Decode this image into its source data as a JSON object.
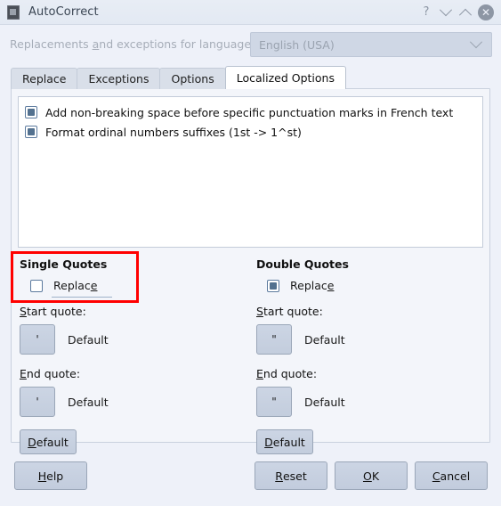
{
  "window": {
    "title": "AutoCorrect",
    "icon": "document-icon",
    "controls": {
      "help": "?",
      "minimize": "chevron-down-icon",
      "maximize": "chevron-up-icon",
      "close": "✕"
    }
  },
  "language": {
    "label_before": "Replacements ",
    "label_mnemonic": "a",
    "label_after": "nd exceptions for language:",
    "value": "English (USA)",
    "enabled": false
  },
  "tabs": [
    {
      "label": "Replace",
      "active": false
    },
    {
      "label": "Exceptions",
      "active": false
    },
    {
      "label": "Options",
      "active": false
    },
    {
      "label": "Localized Options",
      "active": true
    }
  ],
  "list": {
    "items": [
      {
        "label": "Add non-breaking space before specific punctuation marks in French text",
        "checked": true
      },
      {
        "label": "Format ordinal numbers suffixes (1st -> 1^st)",
        "checked": true
      }
    ]
  },
  "single_quotes": {
    "title": "Single Quotes",
    "replace": {
      "label_before": "Replac",
      "label_mnemonic": "e",
      "label_after": "",
      "checked": false,
      "focused": true
    },
    "start": {
      "label_mnemonic": "S",
      "label_after": "tart quote:",
      "glyph": "'",
      "value": "Default"
    },
    "end": {
      "label_mnemonic": "E",
      "label_after": "nd quote:",
      "glyph": "'",
      "value": "Default"
    },
    "default_button": {
      "label_mnemonic": "D",
      "label_after": "efault"
    }
  },
  "double_quotes": {
    "title": "Double Quotes",
    "replace": {
      "label_before": "Replac",
      "label_mnemonic": "e",
      "label_after": "",
      "checked": true,
      "focused": false
    },
    "start": {
      "label_mnemonic": "S",
      "label_after": "tart quote:",
      "glyph": "\"",
      "value": "Default"
    },
    "end": {
      "label_mnemonic": "E",
      "label_after": "nd quote:",
      "glyph": "\"",
      "value": "Default"
    },
    "default_button": {
      "label_mnemonic": "D",
      "label_after": "efault"
    }
  },
  "buttons": {
    "help": {
      "mnemonic": "H",
      "rest": "elp"
    },
    "reset": {
      "mnemonic": "R",
      "rest": "eset"
    },
    "ok": {
      "mnemonic": "O",
      "rest": "K"
    },
    "cancel": {
      "mnemonic": "C",
      "rest": "ancel"
    }
  },
  "annotation": {
    "highlight_color": "#ff0000",
    "target": "single-quotes-replace-checkbox"
  }
}
